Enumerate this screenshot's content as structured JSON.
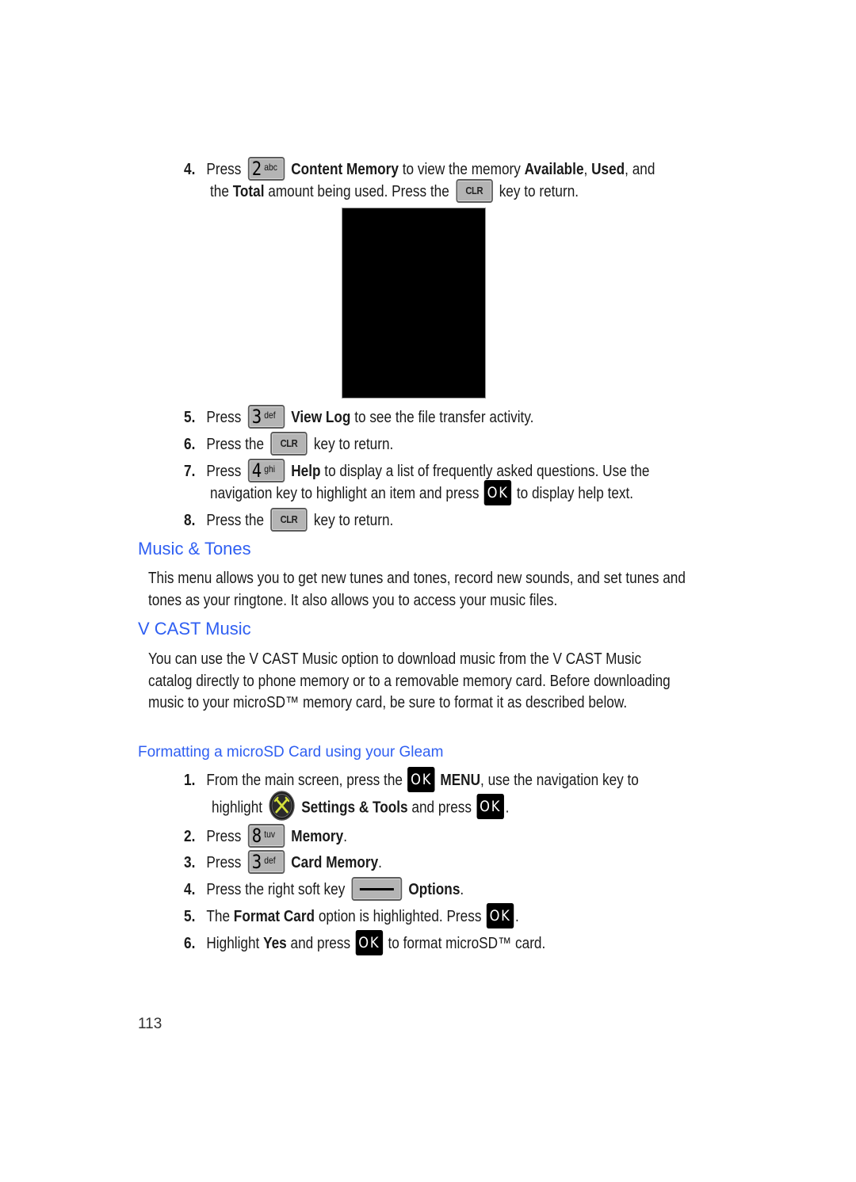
{
  "steps_top": [
    {
      "num": "4.",
      "parts": {
        "a": "Press",
        "key": {
          "digit": "2",
          "letters": "abc"
        },
        "b1": "Content Memory",
        "c": " to view the memory ",
        "b2": "Available",
        "d": ", ",
        "b3": "Used",
        "e": ", and"
      },
      "line2": {
        "a": "the ",
        "b": "Total",
        "c": " amount being used. Press the",
        "key": "CLR",
        "d": "key to return."
      }
    },
    {
      "num": "5.",
      "parts": {
        "a": "Press",
        "key": {
          "digit": "3",
          "letters": "def"
        },
        "b": "View Log",
        "c": " to see the file transfer activity."
      }
    },
    {
      "num": "6.",
      "parts": {
        "a": "Press the",
        "key": "CLR",
        "c": "key to return."
      }
    },
    {
      "num": "7.",
      "parts": {
        "a": "Press",
        "key": {
          "digit": "4",
          "letters": "ghi"
        },
        "b": "Help",
        "c": " to display a list of frequently asked questions. Use the"
      },
      "line2": {
        "a": "navigation key to highlight an item and press",
        "ok": "OK",
        "b": "to display help text."
      }
    },
    {
      "num": "8.",
      "parts": {
        "a": "Press the",
        "key": "CLR",
        "c": "key to return."
      }
    }
  ],
  "sections": {
    "music_tones": {
      "heading": "Music & Tones",
      "body": "This menu allows you to get new tunes and tones, record new sounds, and set tunes and tones as your ringtone. It also allows you to access your music files."
    },
    "vcast_music": {
      "heading": "V CAST Music",
      "body": "You can use the V CAST Music option to download music from the V CAST Music catalog directly to phone memory or to a removable memory card. Before downloading music to your microSD™ memory card, be sure to format it as described below."
    },
    "formatting": {
      "heading": "Formatting a microSD  Card using your Gleam"
    }
  },
  "steps_bottom": [
    {
      "num": "1.",
      "a": "From the main screen, press the",
      "ok": "OK",
      "b": "MENU",
      "c": ", use the navigation key to",
      "line2": {
        "a": "highlight",
        "icon": "settings-tools-icon",
        "b": "Settings & Tools",
        "c": " and press",
        "ok": "OK",
        "d": "."
      }
    },
    {
      "num": "2.",
      "a": "Press",
      "key": {
        "digit": "8",
        "letters": "tuv"
      },
      "b": "Memory",
      "c": "."
    },
    {
      "num": "3.",
      "a": "Press",
      "key": {
        "digit": "3",
        "letters": "def"
      },
      "b": "Card Memory",
      "c": "."
    },
    {
      "num": "4.",
      "a": "Press the right soft key",
      "key": "right-soft-key",
      "b": "Options",
      "c": "."
    },
    {
      "num": "5.",
      "a": "The ",
      "b": "Format Card",
      "c": " option is highlighted. Press",
      "ok": "OK",
      "d": "."
    },
    {
      "num": "6.",
      "a": "Highlight ",
      "b": "Yes",
      "c": " and press",
      "ok": "OK",
      "d": "to format microSD™ card."
    }
  ],
  "key_labels": {
    "clr": "CLR",
    "ok": "OK"
  },
  "page_number": "113",
  "colors": {
    "heading": "#2f5ff2",
    "text": "#1a1a1a",
    "key_fill": "#b4b4b4",
    "settings_icon_accent": "#d4e03a"
  }
}
